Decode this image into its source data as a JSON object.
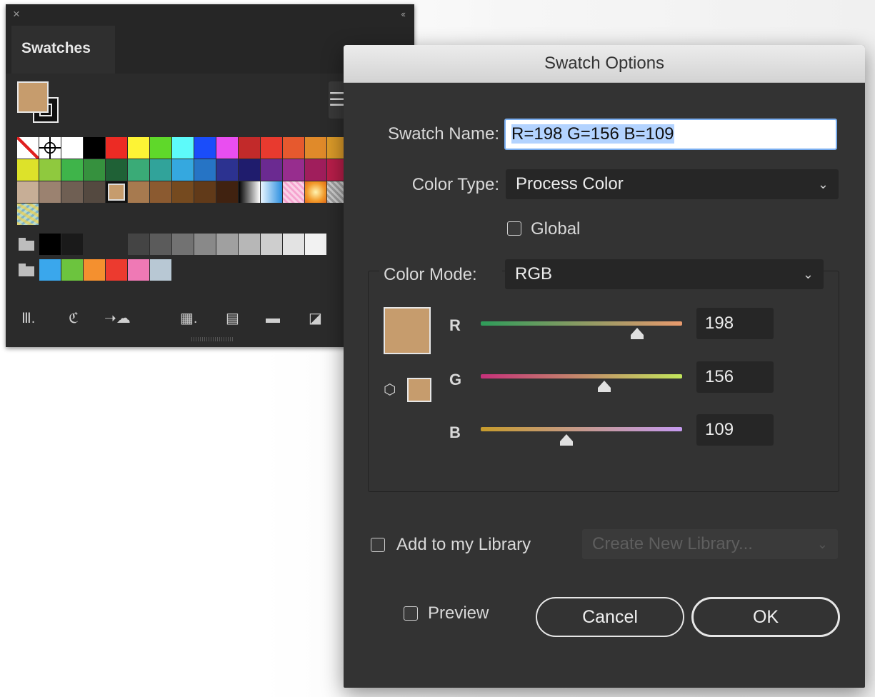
{
  "swatches_panel": {
    "close_glyph": "×",
    "collapse_glyph": "‹‹",
    "tab_label": "Swatches",
    "fill_color": "#c69c6d",
    "grid_rows": [
      [
        "none",
        "registration",
        "#ffffff",
        "#000000",
        "#ec2b24",
        "#fdf335",
        "#5fd82a",
        "#5dfafa",
        "#1a4dfa",
        "#e94ef0",
        "#c22a2a",
        "#e83a2f",
        "#e6592e",
        "#e08a2a",
        "#dc9b29"
      ],
      [
        "#dde22a",
        "#8fc93e",
        "#3fb44a",
        "#36913e",
        "#1f6136",
        "#3aab77",
        "#31a39a",
        "#35a8df",
        "#2674c5",
        "#2c3290",
        "#1f1c6d",
        "#6b2a91",
        "#972d8e",
        "#a01e5c",
        "#b91e4a"
      ],
      [
        "#c7ae96",
        "#9b8270",
        "#6f5f53",
        "#544940",
        "#c69c6d",
        "#a77a4f",
        "#8b5a30",
        "#754a1f",
        "#613a19",
        "#402210",
        "gradient-bw",
        "gradient-blue",
        "pattern-pink",
        "gradient-orange",
        "pattern-grey"
      ],
      [
        "pattern-map"
      ]
    ],
    "gray_group": [
      "#000000",
      "#1a1a1a",
      "#2b2b2b",
      "#444444",
      "#5b5b5b",
      "#727272",
      "#898989",
      "#a0a0a0",
      "#b7b7b7",
      "#cecece",
      "#e3e3e3",
      "#f2f2f2"
    ],
    "bright_group": [
      "#3aa7ec",
      "#6cc43e",
      "#f4902f",
      "#ec3a2f",
      "#ef79b5",
      "#b8c8d4"
    ],
    "toolbar_icons": [
      "libraries-menu-icon",
      "show-swatch-kinds-icon",
      "cloud-sync-icon",
      "swatch-options-icon",
      "color-group-icon",
      "new-folder-icon",
      "new-swatch-icon"
    ]
  },
  "dialog": {
    "title": "Swatch Options",
    "swatch_name_label": "Swatch Name:",
    "swatch_name_value": "R=198 G=156 B=109",
    "color_type_label": "Color Type:",
    "color_type_value": "Process Color",
    "global_label": "Global",
    "color_mode_label": "Color Mode:",
    "color_mode_value": "RGB",
    "preview_color": "#c69c6d",
    "channels": [
      {
        "label": "R",
        "value": "198",
        "fraction": 0.776
      },
      {
        "label": "G",
        "value": "156",
        "fraction": 0.612
      },
      {
        "label": "B",
        "value": "109",
        "fraction": 0.427
      }
    ],
    "add_library_label": "Add to my Library",
    "library_placeholder": "Create New Library...",
    "preview_label": "Preview",
    "cancel_label": "Cancel",
    "ok_label": "OK"
  }
}
